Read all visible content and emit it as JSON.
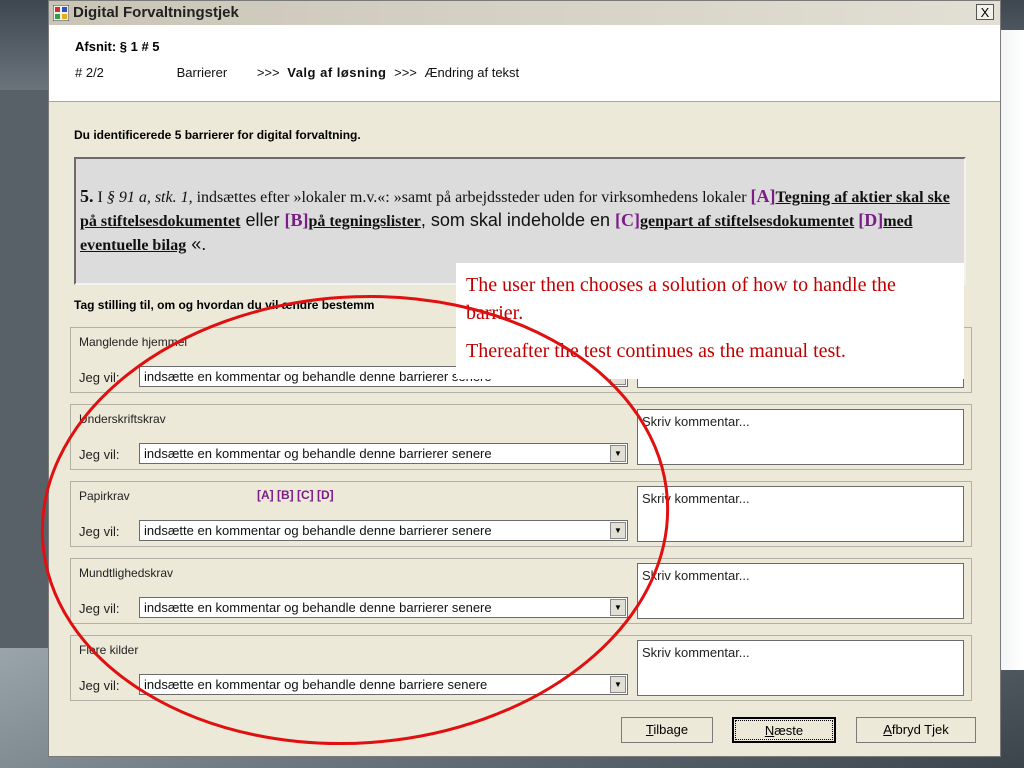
{
  "window": {
    "title": "Digital Forvaltningstjek",
    "close": "X"
  },
  "header": {
    "section": "Afsnit: § 1  # 5",
    "count": "# 2/2",
    "steps": [
      "Barrierer",
      ">>>",
      "Valg af løsning",
      ">>>",
      "Ændring af tekst"
    ]
  },
  "intro": "Du identificerede 5 barrierer for digital forvaltning.",
  "law": {
    "num": "5.",
    "p1": " I ",
    "ref": "§ 91 a, stk. 1,",
    "p2": " indsættes efter »lokaler m.v.«: »samt på arbejdssteder uden for virksomhedens lokaler",
    "tagA": "[A]",
    "textA": "Tegning af aktier skal ske på stiftelsesdokumentet",
    "eller": " eller ",
    "tagB": "[B]",
    "textB": "på tegningslister",
    "mid": ", som skal indeholde en ",
    "tagC": "[C]",
    "textC": "genpart af stiftelsesdokumentet",
    "tagD": "[D]",
    "textD": "med eventuelle bilag",
    "end": " «."
  },
  "prompt": "Tag stilling til, om og hvordan du vil ændre bestemm",
  "groups": [
    {
      "name": "Manglende hjemmel",
      "tags": "",
      "jeg": "Jeg vil:",
      "select": "indsætte en kommentar og behandle denne barrierer senere",
      "comment": ""
    },
    {
      "name": "Underskriftskrav",
      "tags": "",
      "jeg": "Jeg vil:",
      "select": "indsætte en kommentar og behandle denne barrierer senere",
      "comment": "Skriv kommentar..."
    },
    {
      "name": "Papirkrav",
      "tags": "[A] [B] [C] [D]",
      "jeg": "Jeg vil:",
      "select": "indsætte en kommentar og behandle denne barrierer senere",
      "comment": "Skriv kommentar..."
    },
    {
      "name": "Mundtlighedskrav",
      "tags": "",
      "jeg": "Jeg vil:",
      "select": "indsætte en kommentar og behandle denne barrierer senere",
      "comment": "Skriv kommentar..."
    },
    {
      "name": "Flere kilder",
      "tags": "",
      "jeg": "Jeg vil:",
      "select": "indsætte en kommentar og behandle denne barriere senere",
      "comment": "Skriv kommentar..."
    }
  ],
  "buttons": {
    "back_ul": "T",
    "back_rest": "ilbage",
    "next_ul": "N",
    "next_rest": "æste",
    "cancel_ul": "A",
    "cancel_rest": "fbryd Tjek"
  },
  "callout": {
    "line1": "The user then chooses a solution of how to handle the barrier.",
    "line2": "Thereafter the test continues as the manual test."
  },
  "colors": {
    "tag": "#7a1d86",
    "annotation": "#c00000",
    "window_bg": "#ece9d8"
  }
}
